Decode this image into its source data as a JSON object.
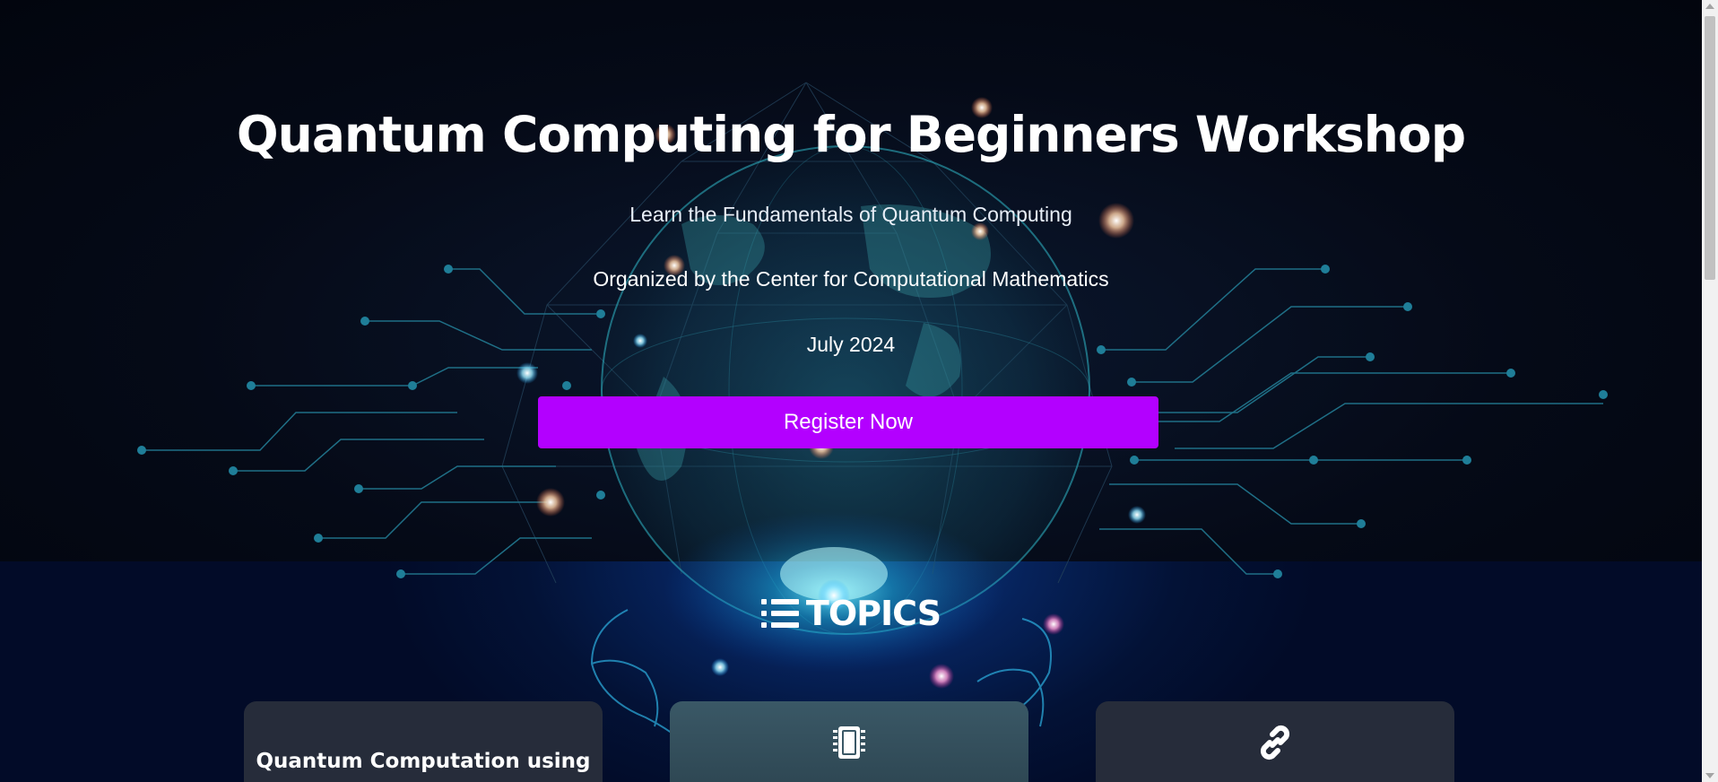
{
  "hero": {
    "title": "Quantum Computing for Beginners Workshop",
    "subtitle": "Learn the Fundamentals of Quantum Computing",
    "organizer": "Organized by the Center for Computational Mathematics",
    "date": "July 2024",
    "register_label": "Register Now"
  },
  "topics": {
    "heading": "TOPICS",
    "heading_icon": "list-icon",
    "cards": [
      {
        "title": "Quantum Computation using",
        "icon": ""
      },
      {
        "title": "",
        "icon": "microchip-icon"
      },
      {
        "title": "",
        "icon": "link-icon"
      }
    ]
  },
  "colors": {
    "hero_background": "#04091a",
    "topics_background": "#031236",
    "accent_button": "#b300ff",
    "card_background": "#262c3a",
    "circuit_lines": "#1f6f86"
  }
}
